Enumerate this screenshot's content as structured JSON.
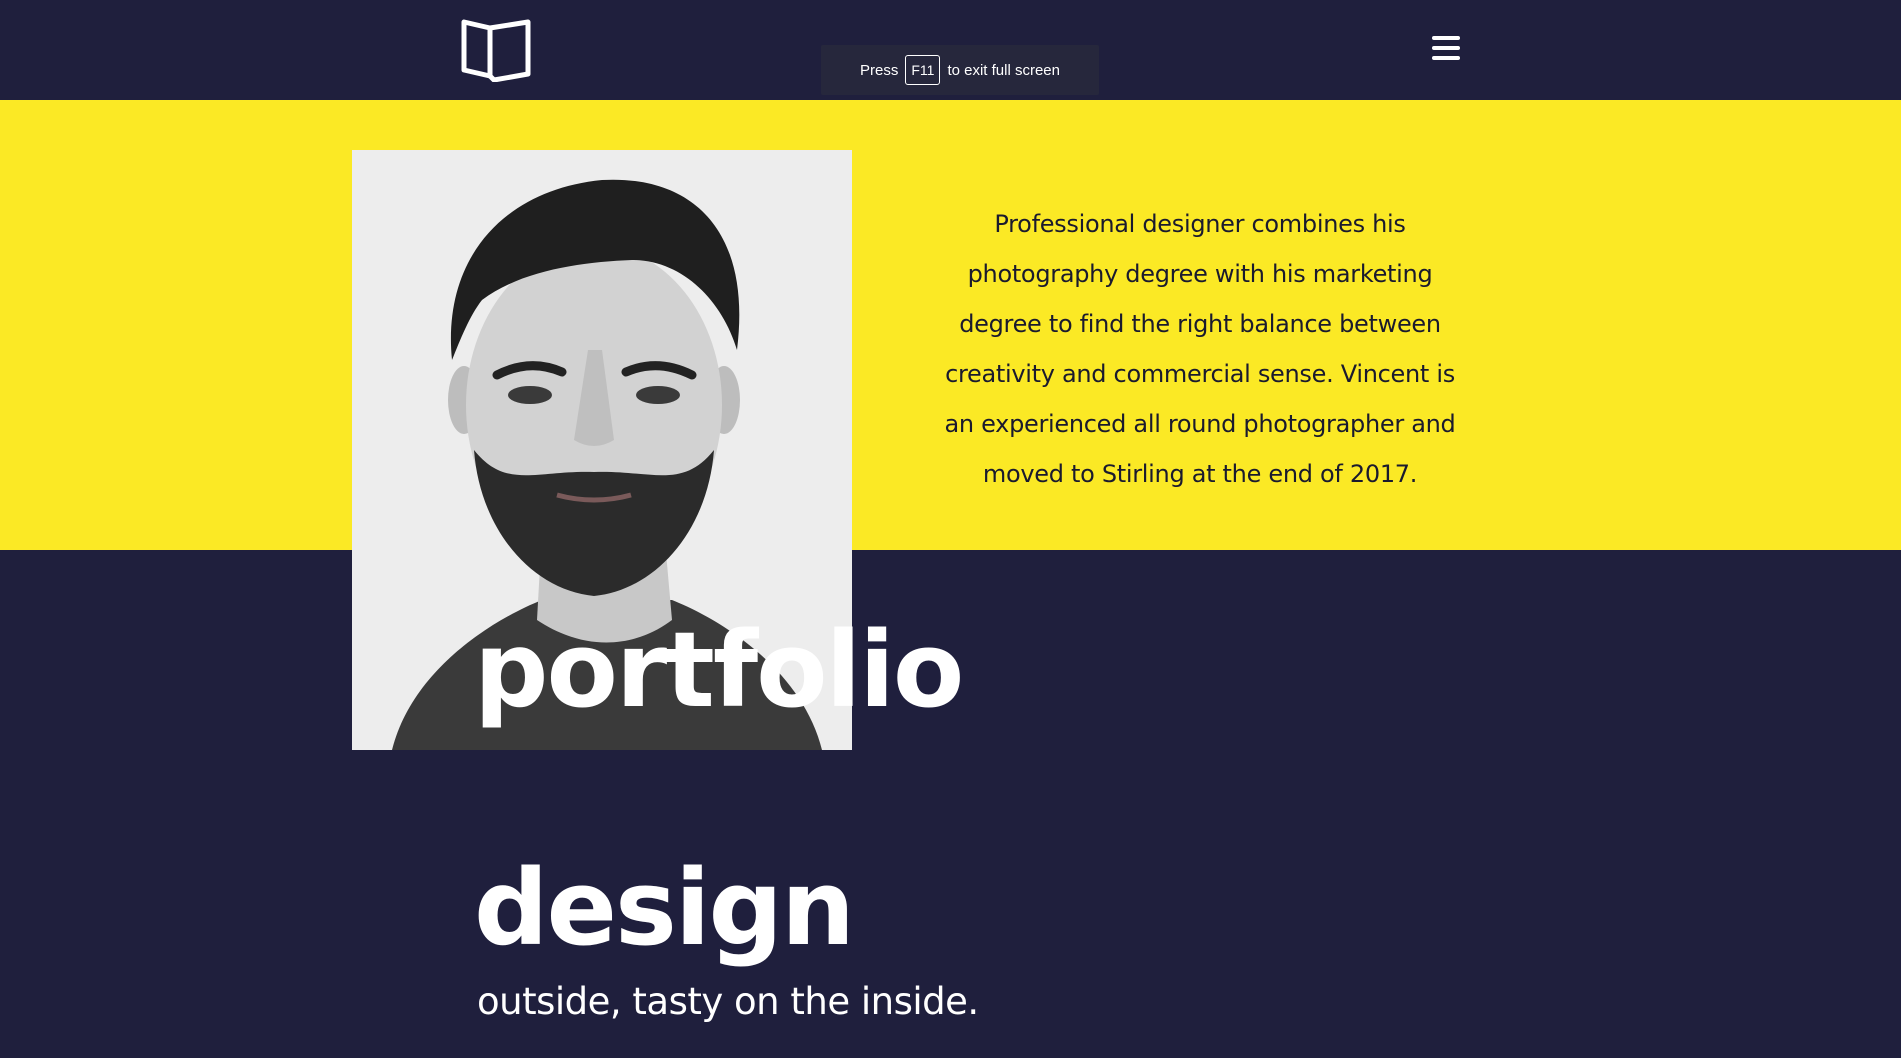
{
  "header": {
    "logo_icon": "open-book-icon",
    "menu_icon": "hamburger-menu-icon"
  },
  "fullscreen_notice": {
    "press": "Press",
    "key": "F11",
    "rest": "to exit full screen"
  },
  "hero": {
    "photo_alt": "Portrait of Vincent",
    "description": "Professional designer combines his photography degree with his marketing degree to find the right balance between creativity and commercial sense. Vincent is an experienced all round photographer and moved to Stirling at the end of 2017."
  },
  "headline": {
    "word1": "portfolio",
    "word2": "design",
    "tagline": "outside, tasty on the inside."
  },
  "colors": {
    "background": "#1f1f3d",
    "accent": "#fbe925",
    "text_light": "#ffffff",
    "text_dark": "#1a1a2e"
  }
}
